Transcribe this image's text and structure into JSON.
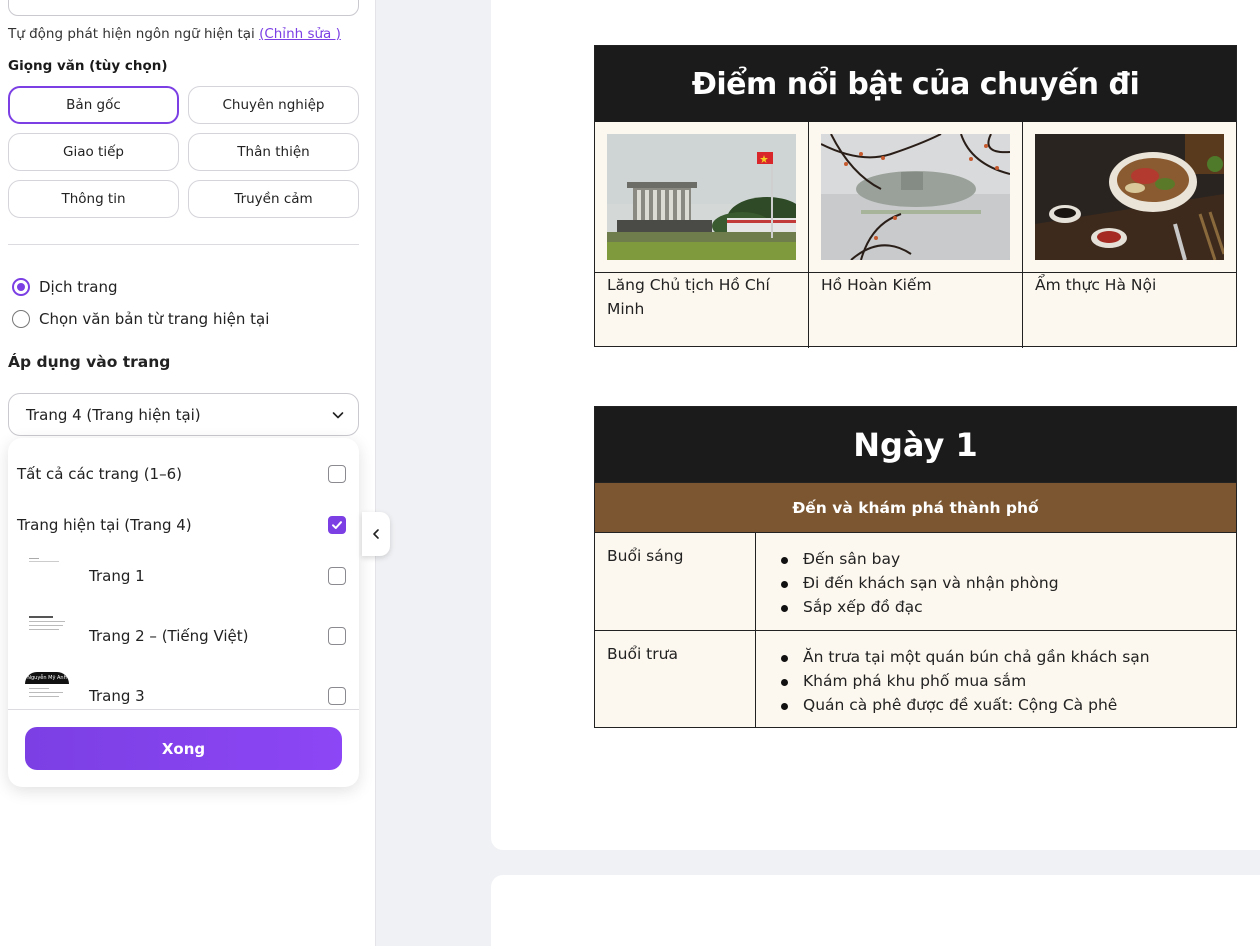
{
  "panel": {
    "auto_detect_text": "Tự động phát hiện ngôn ngữ hiện tại ",
    "auto_detect_link": "(Chỉnh sửa )",
    "tone_label": "Giọng văn (tùy chọn)",
    "tones": [
      {
        "label": "Bản gốc",
        "selected": true
      },
      {
        "label": "Chuyên nghiệp",
        "selected": false
      },
      {
        "label": "Giao tiếp",
        "selected": false
      },
      {
        "label": "Thân thiện",
        "selected": false
      },
      {
        "label": "Thông tin",
        "selected": false
      },
      {
        "label": "Truyền cảm",
        "selected": false
      }
    ],
    "mode_options": [
      {
        "label": "Dịch trang",
        "checked": true
      },
      {
        "label": "Chọn văn bản từ trang hiện tại",
        "checked": false
      }
    ],
    "apply_label": "Áp dụng vào trang",
    "page_select_value": "Trang 4 (Trang hiện tại)",
    "dropdown_items": [
      {
        "label": "Tất cả các trang (1–6)",
        "checked": false
      },
      {
        "label": "Trang hiện tại (Trang 4)",
        "checked": true
      },
      {
        "label": "Trang 1",
        "checked": false
      },
      {
        "label": "Trang 2 – (Tiếng Việt)",
        "checked": false
      },
      {
        "label": "Trang 3",
        "checked": false
      }
    ],
    "thumb3_text": "Nguyễn Mỹ Anh",
    "done_label": "Xong",
    "accent_color": "#7b3fe4"
  },
  "document": {
    "highlights_title": "Điểm nổi bật của chuyến đi",
    "highlights": [
      {
        "caption": "Lăng Chủ tịch Hồ Chí Minh",
        "image": "mausoleum-photo"
      },
      {
        "caption": "Hồ Hoàn Kiếm",
        "image": "lake-photo"
      },
      {
        "caption": "Ẩm thực Hà Nội",
        "image": "pho-photo"
      }
    ],
    "day_title": "Ngày 1",
    "day_subtitle": "Đến và khám phá thành phố",
    "schedule": [
      {
        "time": "Buổi sáng",
        "items": [
          "Đến sân bay",
          "Đi đến khách sạn và nhận phòng",
          "Sắp xếp đồ đạc"
        ]
      },
      {
        "time": "Buổi trưa",
        "items": [
          "Ăn trưa tại một quán bún chả gần khách sạn",
          "Khám phá khu phố mua sắm",
          "Quán cà phê được đề xuất: Cộng Cà phê"
        ]
      }
    ],
    "header_color": "#1b1b1b",
    "subheader_color": "#7b5631"
  }
}
